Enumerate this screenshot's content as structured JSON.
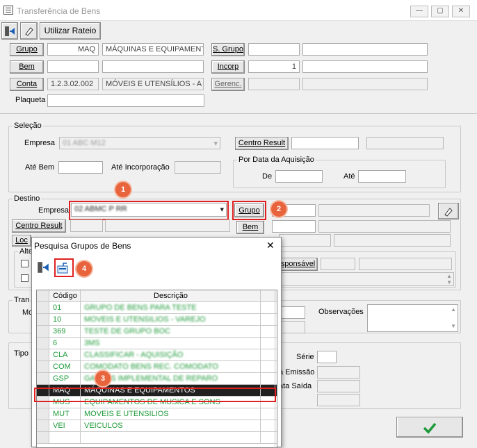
{
  "window": {
    "title": "Transferência de Bens",
    "minimize": "—",
    "maximize": "▢",
    "close": "✕"
  },
  "toolbar": {
    "exit_icon": "exit-door-icon",
    "eraser_icon": "eraser-icon",
    "rateio_label": "Utilizar Rateio"
  },
  "form": {
    "grupo_label": "Grupo",
    "grupo_code": "MAQ",
    "grupo_desc": "MÁQUINAS E EQUIPAMENT",
    "subgrupo_label": "S. Grupo",
    "subgrupo_code": "",
    "subgrupo_desc": "",
    "bem_label": "Bem",
    "bem_code": "",
    "bem_desc": "",
    "incorp_label": "Incorp",
    "incorp_value": "1",
    "incorp_desc": "",
    "conta_label": "Conta",
    "conta_code": "1.2.3.02.002",
    "conta_desc": "MÓVEIS E UTENSÍLIOS - A",
    "gerenc_label": "Gerenc.",
    "gerenc_code": "",
    "gerenc_desc": "",
    "plaqueta_label": "Plaqueta",
    "plaqueta_value": ""
  },
  "selecao": {
    "title": "Seleção",
    "empresa_label": "Empresa",
    "empresa_value": "01 ABC M12",
    "centro_result_label": "Centro Result",
    "ate_bem_label": "Até Bem",
    "ate_incorp_label": "Até Incorporação",
    "por_data_title": "Por Data da Aquisição",
    "de_label": "De",
    "ate_label": "Até"
  },
  "destino": {
    "title": "Destino",
    "empresa_label": "Empresa",
    "empresa_value": "02 ABMC P RR",
    "grupo_label": "Grupo",
    "centro_result_label": "Centro Result",
    "bem_label": "Bem",
    "loc_label": "Loc",
    "alt_label": "Alte",
    "responsavel_label": "sponsável"
  },
  "transf": {
    "title": "Tran",
    "mo_label": "Mo",
    "observacoes_label": "Observações",
    "tipo_label": "Tipo",
    "serie_label": "Série",
    "emissao_label": "a Emissão",
    "saida_label": "ata Saída"
  },
  "ok_icon": "checkmark-icon",
  "badges": [
    "1",
    "2",
    "3",
    "4"
  ],
  "dialog": {
    "title": "Pesquisa Grupos de Bens",
    "close": "✕",
    "exit_icon": "exit-door-icon",
    "select_icon": "select-record-icon",
    "columns": [
      "Código",
      "Descrição"
    ],
    "rows": [
      {
        "code": "01",
        "desc": "GRUPO DE BENS PARA TESTE"
      },
      {
        "code": "10",
        "desc": "MOVEIS E UTENSILIOS - VAREJO"
      },
      {
        "code": "369",
        "desc": "TESTE DE GRUPO BOC"
      },
      {
        "code": "6",
        "desc": "3MS"
      },
      {
        "code": "CLA",
        "desc": "CLASSIFICAR - AQUISIÇÃO"
      },
      {
        "code": "COM",
        "desc": "COMODATO BENS REC. COMODATO"
      },
      {
        "code": "GSP",
        "desc": "GASTOS IMPLEMENTAL DE REPARO"
      },
      {
        "code": "MAQ",
        "desc": "MÁQUINAS E EQUIPAMENTOS"
      },
      {
        "code": "MUS",
        "desc": "EQUIPAMENTOS DE MUSICA E SONS"
      },
      {
        "code": "MUT",
        "desc": "MOVEIS E UTENSILIOS"
      },
      {
        "code": "VEI",
        "desc": "VEICULOS"
      }
    ]
  }
}
